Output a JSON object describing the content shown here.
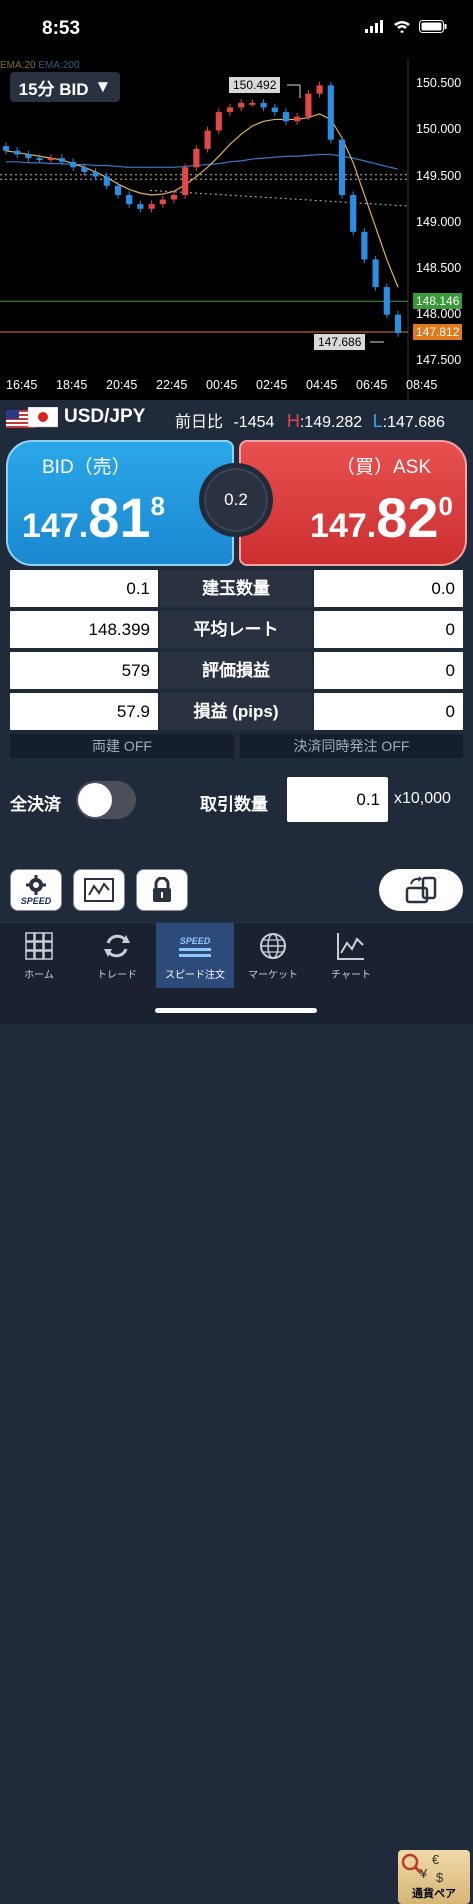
{
  "status": {
    "time": "8:53"
  },
  "chart": {
    "timeframe": "15分 BID",
    "ema_legend": "EMA:20",
    "ema_legend2": "EMA:200",
    "high_label": "150.492",
    "low_label": "147.686",
    "current_ask": "148.146",
    "current_bid": "147.812",
    "y_ticks": [
      "150.500",
      "150.000",
      "149.500",
      "149.000",
      "148.500",
      "148.000",
      "147.500"
    ],
    "x_ticks": [
      "16:45",
      "18:45",
      "20:45",
      "22:45",
      "00:45",
      "02:45",
      "04:45",
      "06:45",
      "08:45"
    ]
  },
  "chart_data": {
    "type": "line",
    "ylim": [
      147.4,
      150.7
    ],
    "y_ticks": [
      150.5,
      150.0,
      149.5,
      149.0,
      148.5,
      148.0,
      147.5
    ],
    "x_ticks": [
      "16:45",
      "18:45",
      "20:45",
      "22:45",
      "00:45",
      "02:45",
      "04:45",
      "06:45",
      "08:45"
    ],
    "price": [
      149.78,
      149.74,
      149.7,
      149.69,
      149.7,
      149.66,
      149.6,
      149.55,
      149.5,
      149.4,
      149.3,
      149.2,
      149.15,
      149.2,
      149.25,
      149.3,
      149.6,
      149.8,
      150.0,
      150.2,
      150.25,
      150.3,
      150.3,
      150.25,
      150.2,
      150.1,
      150.15,
      150.4,
      150.49,
      149.9,
      149.3,
      148.9,
      148.6,
      148.3,
      148.0,
      147.8
    ],
    "ema20": [
      149.78,
      149.76,
      149.74,
      149.72,
      149.7,
      149.68,
      149.64,
      149.6,
      149.55,
      149.49,
      149.42,
      149.36,
      149.32,
      149.3,
      149.31,
      149.34,
      149.41,
      149.5,
      149.6,
      149.72,
      149.85,
      149.96,
      150.05,
      150.1,
      150.12,
      150.12,
      150.12,
      150.14,
      150.18,
      150.12,
      149.92,
      149.65,
      149.3,
      148.95,
      148.6,
      148.3
    ],
    "ema200": [
      149.66,
      149.66,
      149.65,
      149.65,
      149.64,
      149.64,
      149.63,
      149.63,
      149.62,
      149.62,
      149.61,
      149.6,
      149.6,
      149.6,
      149.6,
      149.6,
      149.61,
      149.62,
      149.63,
      149.64,
      149.66,
      149.67,
      149.69,
      149.7,
      149.71,
      149.72,
      149.72,
      149.73,
      149.74,
      149.74,
      149.72,
      149.7,
      149.67,
      149.64,
      149.61,
      149.58
    ],
    "high": 150.492,
    "low": 147.686,
    "ask_line": 148.146,
    "bid_line": 147.812
  },
  "pair": {
    "name": "USD/JPY",
    "prev_label": "前日比",
    "prev_value": "-1454",
    "h_label": "H",
    "h_value": "149.282",
    "l_label": "L",
    "l_value": "147.686"
  },
  "bid": {
    "title": "BID（売）",
    "big1": "147.",
    "big2": "81",
    "small": "8"
  },
  "ask": {
    "title": "（買）ASK",
    "big1": "147.",
    "big2": "82",
    "small": "0"
  },
  "spread": "0.2",
  "rows": [
    {
      "left": "0.1",
      "label": "建玉数量",
      "right": "0.0"
    },
    {
      "left": "148.399",
      "label": "平均レート",
      "right": "0"
    },
    {
      "left": "579",
      "label": "評価損益",
      "right": "0"
    },
    {
      "left": "57.9",
      "label": "損益 (pips)",
      "right": "0"
    }
  ],
  "options": {
    "hedge": "両建 OFF",
    "simultaneous": "決済同時発注 OFF"
  },
  "close_all_label": "全決済",
  "qty": {
    "label": "取引数量",
    "value": "0.1",
    "unit": "x10,000"
  },
  "tools": {
    "speed_label": "SPEED"
  },
  "tabs": [
    {
      "label": "ホーム"
    },
    {
      "label": "トレード"
    },
    {
      "label": "スピード注文"
    },
    {
      "label": "マーケット"
    },
    {
      "label": "チャート"
    },
    {
      "label": "通貨ペア"
    }
  ],
  "colors": {
    "bid": "#1b88d1",
    "ask": "#cc2f2f",
    "ema20": "#e0b25a",
    "ema200": "#3a78c8",
    "up": "#e14848",
    "down": "#2a8fe0"
  }
}
